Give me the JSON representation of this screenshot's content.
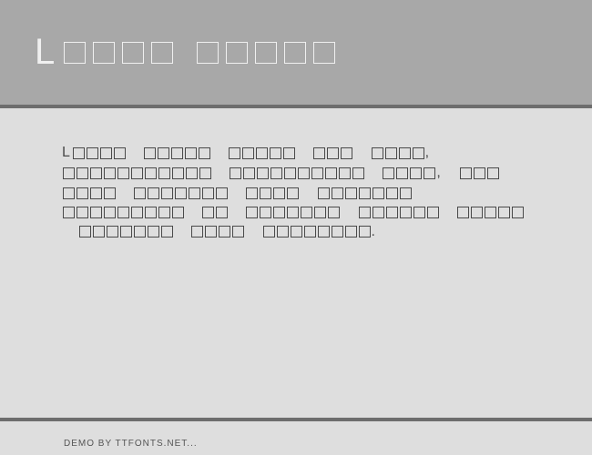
{
  "header": {
    "title_rendered": "L□□□□ □□□□□",
    "title_glyphs": [
      "L",
      "□",
      "□",
      "□",
      "□",
      " ",
      "□",
      "□",
      "□",
      "□",
      "□"
    ]
  },
  "body": {
    "text_rendered": "L□□□□ □□□□□ □□□□□ □□□ □□□□, □□□□□□□□□□□ □□□□□□□□□□ □□□□, □□□ □□□□ □□□□□□□ □□□□ □□□□□□□ □□□□□□□□□ □□ □□□□□□□ □□□□□□ □□□□□ □□□□□□□ □□□□ □□□□□□□□.",
    "word_lengths": [
      [
        "L",
        4
      ],
      5,
      5,
      3,
      [
        4,
        ","
      ],
      11,
      10,
      [
        4,
        ","
      ],
      3,
      4,
      7,
      4,
      7,
      9,
      2,
      7,
      6,
      5,
      7,
      4,
      [
        8,
        "."
      ]
    ]
  },
  "footer": {
    "credit": "DEMO BY TTFONTS.NET..."
  }
}
